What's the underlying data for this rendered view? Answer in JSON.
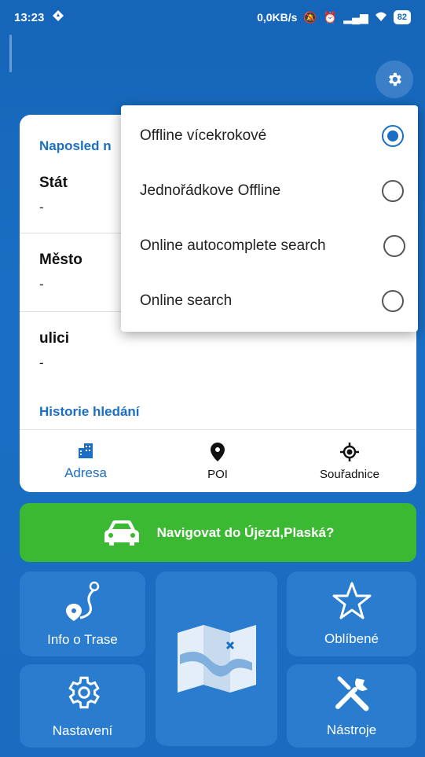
{
  "status": {
    "time": "13:23",
    "net": "0,0KB/s",
    "battery": "82"
  },
  "card": {
    "recent_title": "Naposled n",
    "fields": [
      {
        "label": "Stát",
        "value": "-"
      },
      {
        "label": "Město",
        "value": "-"
      },
      {
        "label": "ulici",
        "value": "-"
      }
    ],
    "history_title": "Historie hledání"
  },
  "tabs": [
    {
      "label": "Adresa",
      "icon": "building-icon"
    },
    {
      "label": "POI",
      "icon": "map-pin-icon"
    },
    {
      "label": "Souřadnice",
      "icon": "crosshair-icon"
    }
  ],
  "dropdown": {
    "options": [
      {
        "label": "Offline vícekrokové",
        "selected": true
      },
      {
        "label": "Jednořádkove Offline",
        "selected": false
      },
      {
        "label": "Online autocomplete search",
        "selected": false
      },
      {
        "label": "Online search",
        "selected": false
      }
    ]
  },
  "navigate": {
    "label": "Navigovat do Újezd,Plaská?"
  },
  "tiles": {
    "route_info": "Info o Trase",
    "favorites": "Oblíbené",
    "settings": "Nastavení",
    "tools": "Nástroje"
  },
  "colors": {
    "accent": "#1a6fc4",
    "green": "#3cb932",
    "tile": "#2a7ccf"
  }
}
